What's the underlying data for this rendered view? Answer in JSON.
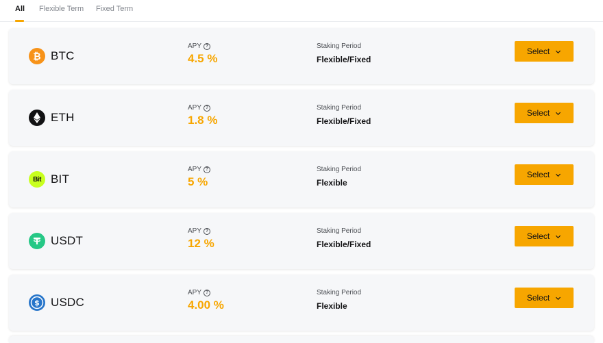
{
  "tabs": [
    {
      "label": "All",
      "active": true
    },
    {
      "label": "Flexible Term",
      "active": false
    },
    {
      "label": "Fixed Term",
      "active": false
    }
  ],
  "apy_label": "APY",
  "period_label": "Staking Period",
  "select_label": "Select",
  "colors": {
    "accent": "#f7a600"
  },
  "coins": [
    {
      "name": "BTC",
      "apy": "4.5 %",
      "period": "Flexible/Fixed",
      "icon": "btc-icon",
      "icon_color": "#f7931a"
    },
    {
      "name": "ETH",
      "apy": "1.8 %",
      "period": "Flexible/Fixed",
      "icon": "eth-icon",
      "icon_color": "#121214"
    },
    {
      "name": "BIT",
      "apy": "5 %",
      "period": "Flexible",
      "icon": "bit-icon",
      "icon_color": "#c8ff1e"
    },
    {
      "name": "USDT",
      "apy": "12 %",
      "period": "Flexible/Fixed",
      "icon": "usdt-icon",
      "icon_color": "#26c886"
    },
    {
      "name": "USDC",
      "apy": "4.00 %",
      "period": "Flexible",
      "icon": "usdc-icon",
      "icon_color": "#2775ca"
    }
  ]
}
